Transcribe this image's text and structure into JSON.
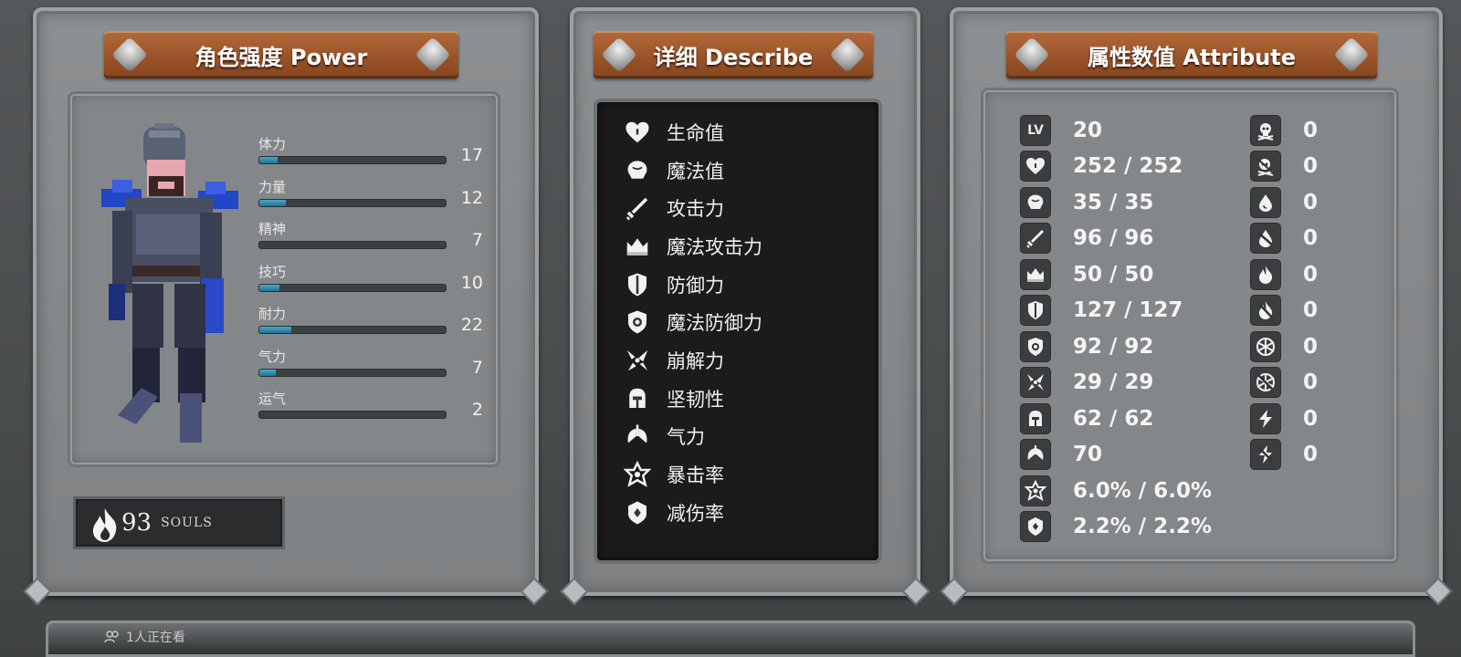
{
  "power_panel": {
    "title": "角色强度 Power",
    "stats": [
      {
        "name": "体力",
        "value": "17",
        "fill": 0.1
      },
      {
        "name": "力量",
        "value": "12",
        "fill": 0.14
      },
      {
        "name": "精神",
        "value": "7",
        "fill": 0.0
      },
      {
        "name": "技巧",
        "value": "10",
        "fill": 0.11
      },
      {
        "name": "耐力",
        "value": "22",
        "fill": 0.17
      },
      {
        "name": "气力",
        "value": "7",
        "fill": 0.09
      },
      {
        "name": "运气",
        "value": "2",
        "fill": 0.0
      }
    ],
    "souls_count": "93",
    "souls_label": "SOULS"
  },
  "describe_panel": {
    "title": "详细 Describe",
    "items": [
      {
        "icon": "heart-icon",
        "label": "生命值"
      },
      {
        "icon": "brain-icon",
        "label": "魔法值"
      },
      {
        "icon": "sword-icon",
        "label": "攻击力"
      },
      {
        "icon": "crown-icon",
        "label": "魔法攻击力"
      },
      {
        "icon": "shield-icon",
        "label": "防御力"
      },
      {
        "icon": "magic-shield-icon",
        "label": "魔法防御力"
      },
      {
        "icon": "shatter-icon",
        "label": "崩解力"
      },
      {
        "icon": "helmet-icon",
        "label": "坚韧性"
      },
      {
        "icon": "lungs-icon",
        "label": "气力"
      },
      {
        "icon": "star-icon",
        "label": "暴击率"
      },
      {
        "icon": "reduce-icon",
        "label": "减伤率"
      }
    ]
  },
  "attribute_panel": {
    "title": "属性数值 Attribute",
    "level_badge": "LV",
    "left": [
      {
        "icon": "level-icon",
        "value": "20"
      },
      {
        "icon": "heart-icon",
        "value": "252 / 252"
      },
      {
        "icon": "brain-icon",
        "value": "35 / 35"
      },
      {
        "icon": "sword-icon",
        "value": "96 / 96"
      },
      {
        "icon": "crown-icon",
        "value": "50 / 50"
      },
      {
        "icon": "shield-icon",
        "value": "127 / 127"
      },
      {
        "icon": "magic-shield-icon",
        "value": "92 / 92"
      },
      {
        "icon": "shatter-icon",
        "value": "29 / 29"
      },
      {
        "icon": "helmet-icon",
        "value": "62 / 62"
      },
      {
        "icon": "lungs-icon",
        "value": "70"
      },
      {
        "icon": "star-icon",
        "value": "6.0% / 6.0%"
      },
      {
        "icon": "reduce-icon",
        "value": "2.2% / 2.2%"
      }
    ],
    "right": [
      {
        "icon": "skull-icon",
        "value": "0"
      },
      {
        "icon": "poison-skull-icon",
        "value": "0"
      },
      {
        "icon": "blood-drop-icon",
        "value": "0"
      },
      {
        "icon": "bleed-icon",
        "value": "0"
      },
      {
        "icon": "fire-icon",
        "value": "0"
      },
      {
        "icon": "fire-resist-icon",
        "value": "0"
      },
      {
        "icon": "frost-icon",
        "value": "0"
      },
      {
        "icon": "frost-resist-icon",
        "value": "0"
      },
      {
        "icon": "lightning-icon",
        "value": "0"
      },
      {
        "icon": "lightning-resist-icon",
        "value": "0"
      }
    ]
  },
  "overlay": {
    "viewers": "1人正在看"
  },
  "colors": {
    "panel": "#8d9092",
    "plaque": "#9a5329",
    "bar_fill": "#2b88ab",
    "describe_bg": "#1d1b1a"
  }
}
